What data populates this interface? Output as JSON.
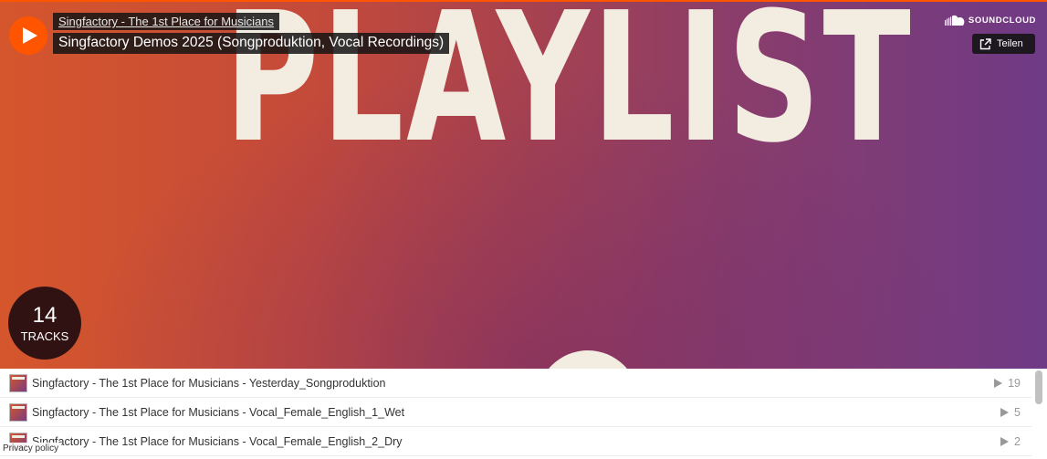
{
  "header": {
    "artist": "Singfactory - The 1st Place for Musicians",
    "title": "Singfactory Demos 2025 (Songproduktion, Vocal Recordings)",
    "brand": "SOUNDCLOUD",
    "share_label": "Teilen"
  },
  "artwork": {
    "text": "PLAYLIST"
  },
  "tracks_count": {
    "number": "14",
    "label": "TRACKS"
  },
  "tracks": [
    {
      "title": "Singfactory - The 1st Place for Musicians - Yesterday_Songproduktion",
      "plays": "19"
    },
    {
      "title": "Singfactory - The 1st Place for Musicians - Vocal_Female_English_1_Wet",
      "plays": "5"
    },
    {
      "title": "Singfactory - The 1st Place for Musicians - Vocal_Female_English_2_Dry",
      "plays": "2"
    }
  ],
  "footer": {
    "privacy": "Privacy policy"
  },
  "colors": {
    "accent": "#ff5500",
    "badge": "#301212"
  },
  "icons": {
    "play": "play-icon",
    "logo": "soundcloud-cloud-icon",
    "share": "share-icon",
    "play_count": "play-count-icon"
  }
}
